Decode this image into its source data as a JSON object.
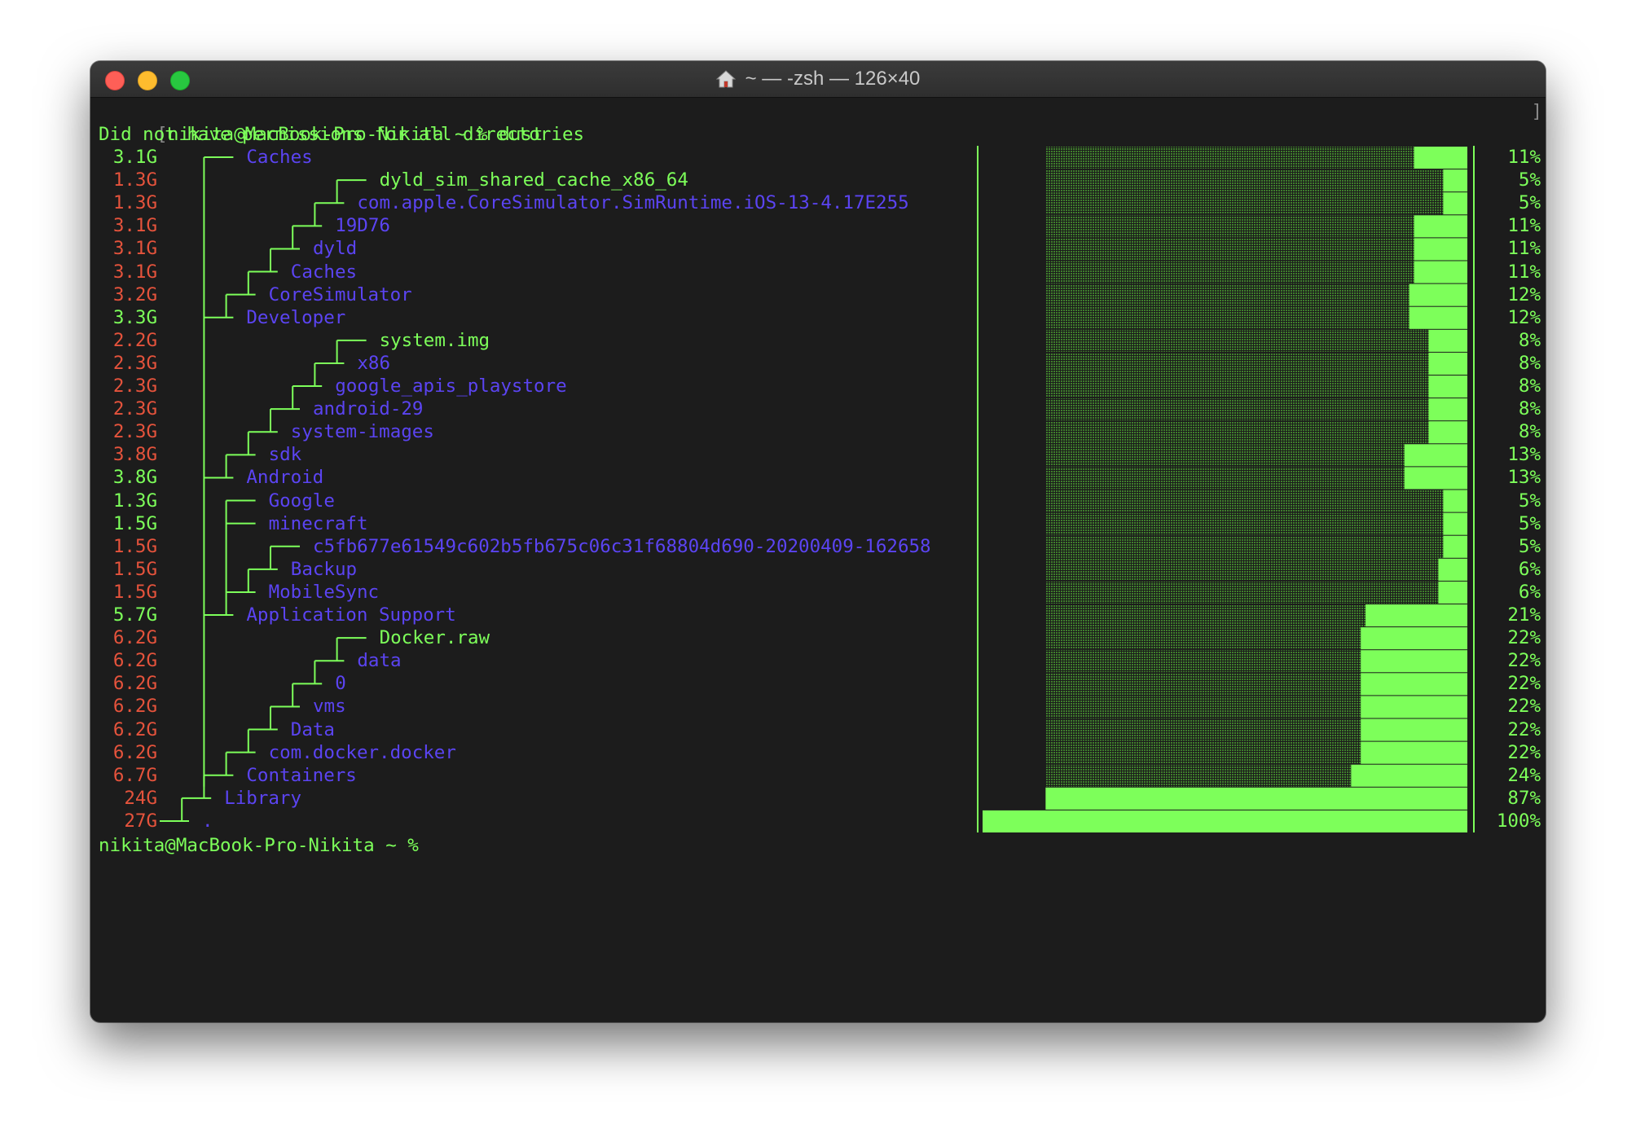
{
  "window": {
    "title": "~ — -zsh — 126×40"
  },
  "terminal": {
    "command_line": "nikita@MacBook-Pro-Nikita ~ % dust",
    "bracket_left": "[",
    "bracket_right": "]",
    "warning": "Did not have permissions for all directories",
    "final_prompt": "nikita@MacBook-Pro-Nikita ~ %",
    "rows": [
      {
        "size": "3.1G",
        "size_color": "green",
        "depth": 2,
        "name": "Caches",
        "name_color": "blue",
        "percent": "11%",
        "bar_fraction": 0.11
      },
      {
        "size": "1.3G",
        "size_color": "red",
        "depth": 8,
        "name": "dyld_sim_shared_cache_x86_64",
        "name_color": "green",
        "percent": "5%",
        "bar_fraction": 0.05
      },
      {
        "size": "1.3G",
        "size_color": "red",
        "depth": 7,
        "name": "com.apple.CoreSimulator.SimRuntime.iOS-13-4.17E255",
        "name_color": "blue",
        "percent": "5%",
        "bar_fraction": 0.05
      },
      {
        "size": "3.1G",
        "size_color": "red",
        "depth": 6,
        "name": "19D76",
        "name_color": "blue",
        "percent": "11%",
        "bar_fraction": 0.11
      },
      {
        "size": "3.1G",
        "size_color": "red",
        "depth": 5,
        "name": "dyld",
        "name_color": "blue",
        "percent": "11%",
        "bar_fraction": 0.11
      },
      {
        "size": "3.1G",
        "size_color": "red",
        "depth": 4,
        "name": "Caches",
        "name_color": "blue",
        "percent": "11%",
        "bar_fraction": 0.11
      },
      {
        "size": "3.2G",
        "size_color": "red",
        "depth": 3,
        "name": "CoreSimulator",
        "name_color": "blue",
        "percent": "12%",
        "bar_fraction": 0.12
      },
      {
        "size": "3.3G",
        "size_color": "green",
        "depth": 2,
        "name": "Developer",
        "name_color": "blue",
        "percent": "12%",
        "bar_fraction": 0.12
      },
      {
        "size": "2.2G",
        "size_color": "red",
        "depth": 8,
        "name": "system.img",
        "name_color": "green",
        "percent": "8%",
        "bar_fraction": 0.08
      },
      {
        "size": "2.3G",
        "size_color": "red",
        "depth": 7,
        "name": "x86",
        "name_color": "blue",
        "percent": "8%",
        "bar_fraction": 0.08
      },
      {
        "size": "2.3G",
        "size_color": "red",
        "depth": 6,
        "name": "google_apis_playstore",
        "name_color": "blue",
        "percent": "8%",
        "bar_fraction": 0.08
      },
      {
        "size": "2.3G",
        "size_color": "red",
        "depth": 5,
        "name": "android-29",
        "name_color": "blue",
        "percent": "8%",
        "bar_fraction": 0.08
      },
      {
        "size": "2.3G",
        "size_color": "red",
        "depth": 4,
        "name": "system-images",
        "name_color": "blue",
        "percent": "8%",
        "bar_fraction": 0.08
      },
      {
        "size": "3.8G",
        "size_color": "red",
        "depth": 3,
        "name": "sdk",
        "name_color": "blue",
        "percent": "13%",
        "bar_fraction": 0.13
      },
      {
        "size": "3.8G",
        "size_color": "green",
        "depth": 2,
        "name": "Android",
        "name_color": "blue",
        "percent": "13%",
        "bar_fraction": 0.13
      },
      {
        "size": "1.3G",
        "size_color": "green",
        "depth": 3,
        "name": "Google",
        "name_color": "blue",
        "percent": "5%",
        "bar_fraction": 0.05
      },
      {
        "size": "1.5G",
        "size_color": "green",
        "depth": 3,
        "name": "minecraft",
        "name_color": "blue",
        "percent": "5%",
        "bar_fraction": 0.05
      },
      {
        "size": "1.5G",
        "size_color": "red",
        "depth": 5,
        "name": "c5fb677e61549c602b5fb675c06c31f68804d690-20200409-162658",
        "name_color": "blue",
        "percent": "5%",
        "bar_fraction": 0.05
      },
      {
        "size": "1.5G",
        "size_color": "red",
        "depth": 4,
        "name": "Backup",
        "name_color": "blue",
        "percent": "6%",
        "bar_fraction": 0.06
      },
      {
        "size": "1.5G",
        "size_color": "red",
        "depth": 3,
        "name": "MobileSync",
        "name_color": "blue",
        "percent": "6%",
        "bar_fraction": 0.06
      },
      {
        "size": "5.7G",
        "size_color": "green",
        "depth": 2,
        "name": "Application Support",
        "name_color": "blue",
        "percent": "21%",
        "bar_fraction": 0.21
      },
      {
        "size": "6.2G",
        "size_color": "red",
        "depth": 8,
        "name": "Docker.raw",
        "name_color": "green",
        "percent": "22%",
        "bar_fraction": 0.22
      },
      {
        "size": "6.2G",
        "size_color": "red",
        "depth": 7,
        "name": "data",
        "name_color": "blue",
        "percent": "22%",
        "bar_fraction": 0.22
      },
      {
        "size": "6.2G",
        "size_color": "red",
        "depth": 6,
        "name": "0",
        "name_color": "blue",
        "percent": "22%",
        "bar_fraction": 0.22
      },
      {
        "size": "6.2G",
        "size_color": "red",
        "depth": 5,
        "name": "vms",
        "name_color": "blue",
        "percent": "22%",
        "bar_fraction": 0.22
      },
      {
        "size": "6.2G",
        "size_color": "red",
        "depth": 4,
        "name": "Data",
        "name_color": "blue",
        "percent": "22%",
        "bar_fraction": 0.22
      },
      {
        "size": "6.2G",
        "size_color": "red",
        "depth": 3,
        "name": "com.docker.docker",
        "name_color": "blue",
        "percent": "22%",
        "bar_fraction": 0.22
      },
      {
        "size": "6.7G",
        "size_color": "red",
        "depth": 2,
        "name": "Containers",
        "name_color": "blue",
        "percent": "24%",
        "bar_fraction": 0.24
      },
      {
        "size": "24G",
        "size_color": "red",
        "depth": 1,
        "name": "Library",
        "name_color": "blue",
        "percent": "87%",
        "bar_fraction": 0.87
      },
      {
        "size": "27G",
        "size_color": "red",
        "depth": 0,
        "name": ".",
        "name_color": "blue",
        "percent": "100%",
        "bar_fraction": 1.0
      }
    ]
  },
  "colors": {
    "background": "#1c1c1c",
    "green": "#7dff5a",
    "red": "#e5533c",
    "blue": "#5b44f2"
  }
}
